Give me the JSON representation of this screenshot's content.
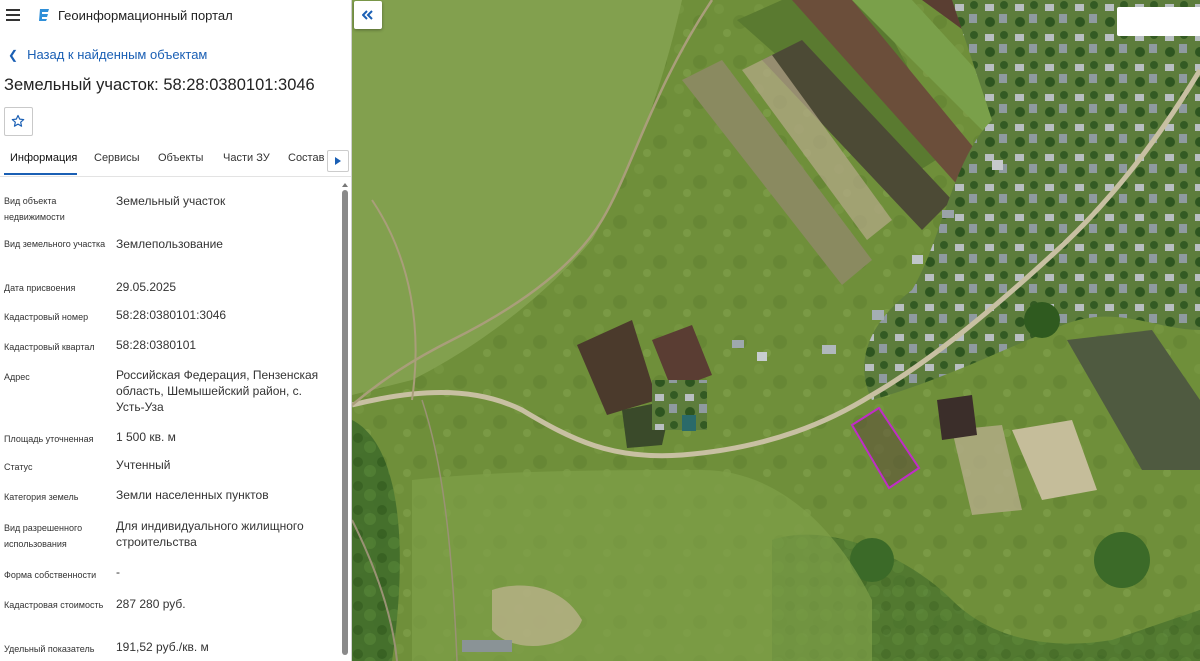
{
  "header": {
    "portal_title": "Геоинформационный портал",
    "menu_icon": "hamburger-menu-icon",
    "logo_icon": "portal-logo-icon"
  },
  "navigation": {
    "back_label": "Назад к найденным объектам"
  },
  "object": {
    "title": "Земельный участок: 58:28:0380101:3046"
  },
  "tabs": [
    {
      "label": "Информация",
      "active": true
    },
    {
      "label": "Сервисы",
      "active": false
    },
    {
      "label": "Объекты",
      "active": false
    },
    {
      "label": "Части ЗУ",
      "active": false
    },
    {
      "label": "Состав",
      "active": false
    }
  ],
  "properties": [
    {
      "label": "Вид объекта недвижимости",
      "value": "Земельный участок"
    },
    {
      "label": "Вид земельного участка",
      "value": "Землепользование"
    },
    {
      "label": "Дата присвоения",
      "value": "29.05.2025"
    },
    {
      "label": "Кадастровый номер",
      "value": "58:28:0380101:3046"
    },
    {
      "label": "Кадастровый квартал",
      "value": "58:28:0380101"
    },
    {
      "label": "Адрес",
      "value": "Российская Федерация, Пензенская область, Шемышейский район, с. Усть-Уза"
    },
    {
      "label": "Площадь уточненная",
      "value": "1 500 кв. м"
    },
    {
      "label": "Статус",
      "value": "Учтенный"
    },
    {
      "label": "Категория земель",
      "value": "Земли населенных пунктов"
    },
    {
      "label": "Вид разрешенного использования",
      "value": "Для индивидуального жилищного строительства"
    },
    {
      "label": "Форма собственности",
      "value": "-"
    },
    {
      "label": "Кадастровая стоимость",
      "value": "287 280 руб."
    },
    {
      "label": "Удельный показатель",
      "value": "191,52 руб./кв. м"
    }
  ],
  "colors": {
    "accent": "#1a5fb4",
    "parcel_outline": "#c02cc8"
  }
}
